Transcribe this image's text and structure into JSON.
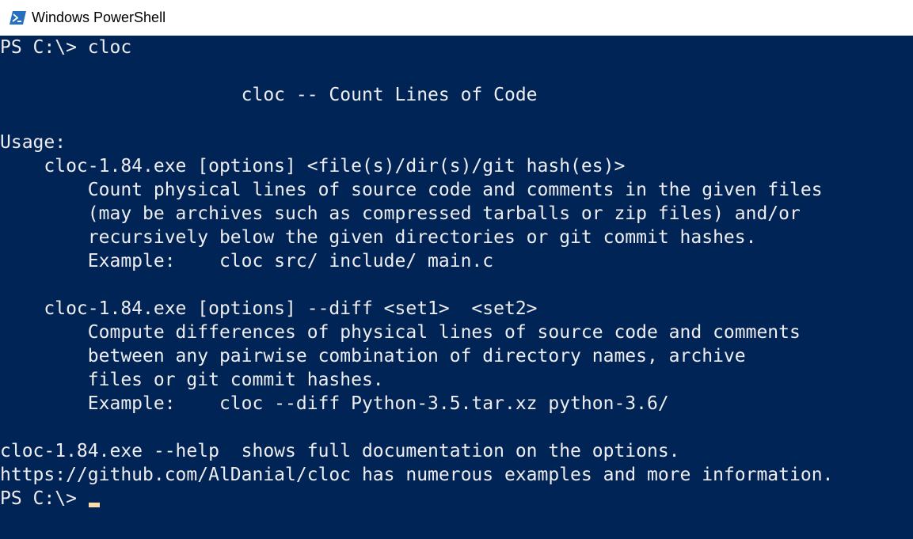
{
  "window": {
    "title": "Windows PowerShell",
    "icon": "powershell-icon"
  },
  "colors": {
    "background": "#012456",
    "foreground": "#eeedf0",
    "cursor": "#fedba9"
  },
  "terminal": {
    "lines": [
      "PS C:\\> cloc",
      "",
      "                      cloc -- Count Lines of Code",
      "",
      "Usage:",
      "    cloc-1.84.exe [options] <file(s)/dir(s)/git hash(es)>",
      "        Count physical lines of source code and comments in the given files",
      "        (may be archives such as compressed tarballs or zip files) and/or",
      "        recursively below the given directories or git commit hashes.",
      "        Example:    cloc src/ include/ main.c",
      "",
      "    cloc-1.84.exe [options] --diff <set1>  <set2>",
      "        Compute differences of physical lines of source code and comments",
      "        between any pairwise combination of directory names, archive",
      "        files or git commit hashes.",
      "        Example:    cloc --diff Python-3.5.tar.xz python-3.6/",
      "",
      "cloc-1.84.exe --help  shows full documentation on the options.",
      "https://github.com/AlDanial/cloc has numerous examples and more information.",
      "PS C:\\> "
    ]
  }
}
